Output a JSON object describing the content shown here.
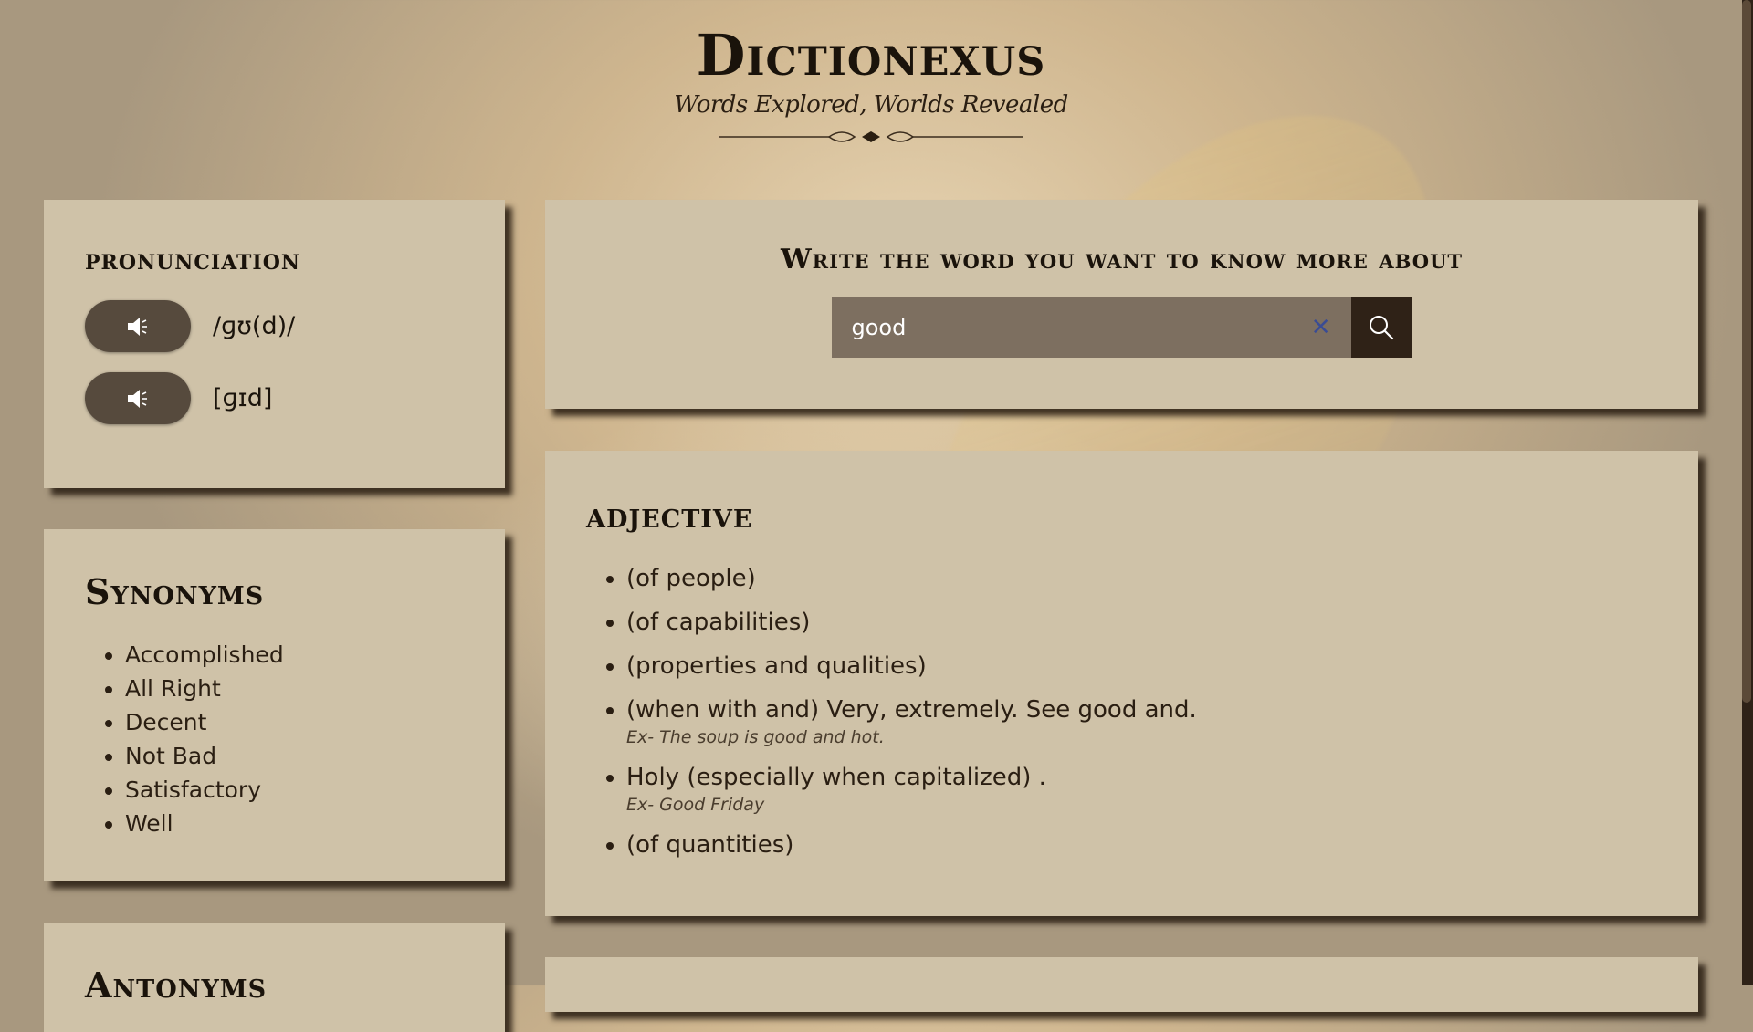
{
  "header": {
    "title": "Dictionexus",
    "tagline": "Words Explored, Worlds Revealed"
  },
  "pronunciation": {
    "heading": "pronunciation",
    "items": [
      {
        "ipa": "/ɡʊ(d)/"
      },
      {
        "ipa": "[ɡɪd]"
      }
    ],
    "icon": "speaker-icon"
  },
  "synonyms": {
    "heading": "Synonyms",
    "items": [
      "Accomplished",
      "All Right",
      "Decent",
      "Not Bad",
      "Satisfactory",
      "Well"
    ]
  },
  "antonyms": {
    "heading": "Antonyms"
  },
  "search": {
    "heading": "Write the word you want to know more about",
    "value": "good",
    "clear_icon": "close-icon",
    "button_icon": "search-icon"
  },
  "definitions": {
    "heading": "adjective",
    "items": [
      {
        "text": "(of people)"
      },
      {
        "text": "(of capabilities)"
      },
      {
        "text": "(properties and qualities)"
      },
      {
        "text": "(when with and) Very, extremely. See good and.",
        "example": "Ex- The soup is good and hot."
      },
      {
        "text": "Holy (especially when capitalized) .",
        "example": "Ex- Good Friday"
      },
      {
        "text": "(of quantities)"
      }
    ]
  },
  "colors": {
    "card": "#cfc2a8",
    "button": "#564a3d",
    "search_field": "#7d6f60",
    "search_button": "#2f2217"
  }
}
